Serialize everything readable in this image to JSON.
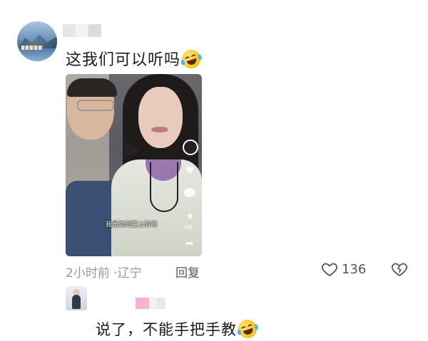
{
  "comment": {
    "text": "这我们可以听吗",
    "emoji": "rofl-emoji",
    "time": "2小时前",
    "separator": "·",
    "location": "辽宁",
    "reply_label": "回复",
    "like_count": "136",
    "like_icon": "heart-outline-icon",
    "dislike_icon": "broken-heart-icon"
  },
  "video": {
    "subtitle": "我是如何要上的吧",
    "side_star_label": "收藏"
  },
  "reply": {
    "text": "说了，不能手把手教",
    "emoji": "rofl-emoji"
  }
}
